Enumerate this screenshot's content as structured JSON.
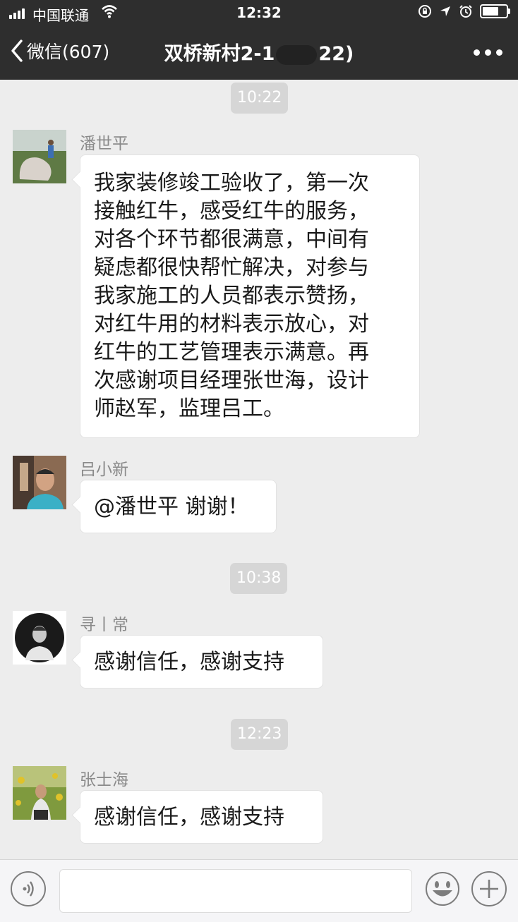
{
  "status_bar": {
    "carrier": "中国联通",
    "time": "12:32",
    "signal_bars": 4,
    "battery_level_fraction": 0.6
  },
  "nav": {
    "back_label": "微信(607)",
    "title_start": "双桥新村2-1",
    "title_end": "22)"
  },
  "messages": [
    {
      "type": "timestamp",
      "text": "10:22"
    },
    {
      "type": "message",
      "sender": "潘世平",
      "avatar_icon": "avatar-photo-rock-icon",
      "lines": [
        "我家装修竣工验收了，第一次",
        "接触红牛，感受红牛的服务，",
        "对各个环节都很满意，中间有",
        "疑虑都很快帮忙解决，对参与",
        "我家施工的人员都表示赞扬，",
        "对红牛用的材料表示放心，对",
        "红牛的工艺管理表示满意。再",
        "次感谢项目经理张世海，设计",
        "师赵军，监理吕工。"
      ]
    },
    {
      "type": "message",
      "sender": "吕小新",
      "avatar_icon": "avatar-photo-man-icon",
      "lines": [
        "@潘世平 谢谢！"
      ]
    },
    {
      "type": "timestamp",
      "text": "10:38"
    },
    {
      "type": "message",
      "sender": "寻丨常",
      "avatar_icon": "avatar-photo-circle-icon",
      "lines": [
        "感谢信任，感谢支持"
      ]
    },
    {
      "type": "timestamp",
      "text": "12:23"
    },
    {
      "type": "message",
      "sender": "张士海",
      "avatar_icon": "avatar-photo-field-icon",
      "lines": [
        "感谢信任，感谢支持"
      ]
    }
  ],
  "colors": {
    "nav_bg": "#2e2e2e",
    "chat_bg": "#ededed",
    "bubble_bg": "#ffffff",
    "timestamp_bg": "#d6d6d6",
    "sender_name": "#8a8a8a"
  }
}
